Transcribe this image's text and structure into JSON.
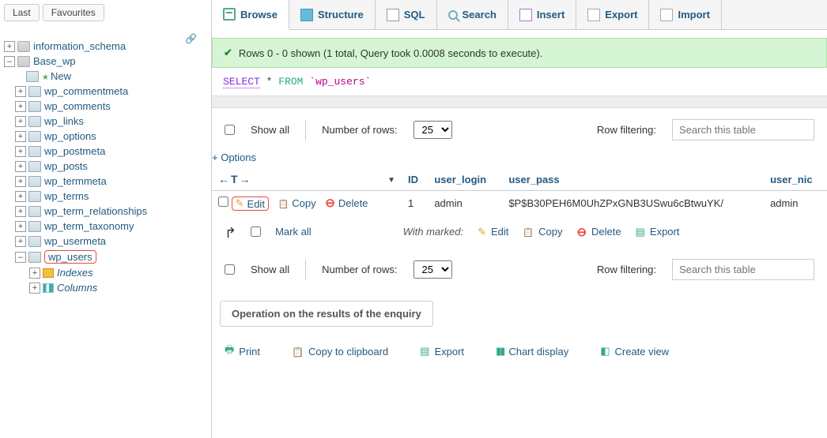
{
  "sidebar": {
    "tabs": [
      "Last",
      "Favourites"
    ],
    "tree": {
      "db1": "information_schema",
      "db2": "Base_wp",
      "new": "New",
      "tables": [
        "wp_commentmeta",
        "wp_comments",
        "wp_links",
        "wp_options",
        "wp_postmeta",
        "wp_posts",
        "wp_termmeta",
        "wp_terms",
        "wp_term_relationships",
        "wp_term_taxonomy",
        "wp_usermeta",
        "wp_users"
      ],
      "sub": {
        "indexes": "Indexes",
        "columns": "Columns"
      }
    }
  },
  "tabs": {
    "browse": "Browse",
    "structure": "Structure",
    "sql": "SQL",
    "search": "Search",
    "insert": "Insert",
    "export": "Export",
    "import": "Import"
  },
  "success_msg": "Rows 0 - 0 shown (1 total, Query took 0.0008 seconds to execute).",
  "sql": {
    "select": "SELECT",
    "star": "*",
    "from": "FROM",
    "table": "`wp_users`"
  },
  "controls": {
    "show_all": "Show all",
    "num_rows_label": "Number of rows:",
    "num_rows_value": "25",
    "filter_label": "Row filtering:",
    "filter_placeholder": "Search this table"
  },
  "options_link": "+ Options",
  "table": {
    "headers": {
      "arrows": "←T→",
      "id": "ID",
      "user_login": "user_login",
      "user_pass": "user_pass",
      "user_nice": "user_nic"
    },
    "row": {
      "edit": "Edit",
      "copy": "Copy",
      "delete": "Delete",
      "id": "1",
      "login": "admin",
      "pass": "$P$B30PEH6M0UhZPxGNB3USwu6cBtwuYK/",
      "nice": "admin"
    }
  },
  "mark": {
    "mark_all": "Mark all",
    "with_marked": "With marked:",
    "edit": "Edit",
    "copy": "Copy",
    "delete": "Delete",
    "export": "Export"
  },
  "section_title": "Operation on the results of the enquiry",
  "bottom": {
    "print": "Print",
    "copy_clip": "Copy to clipboard",
    "export": "Export",
    "chart": "Chart display",
    "create_view": "Create view"
  }
}
